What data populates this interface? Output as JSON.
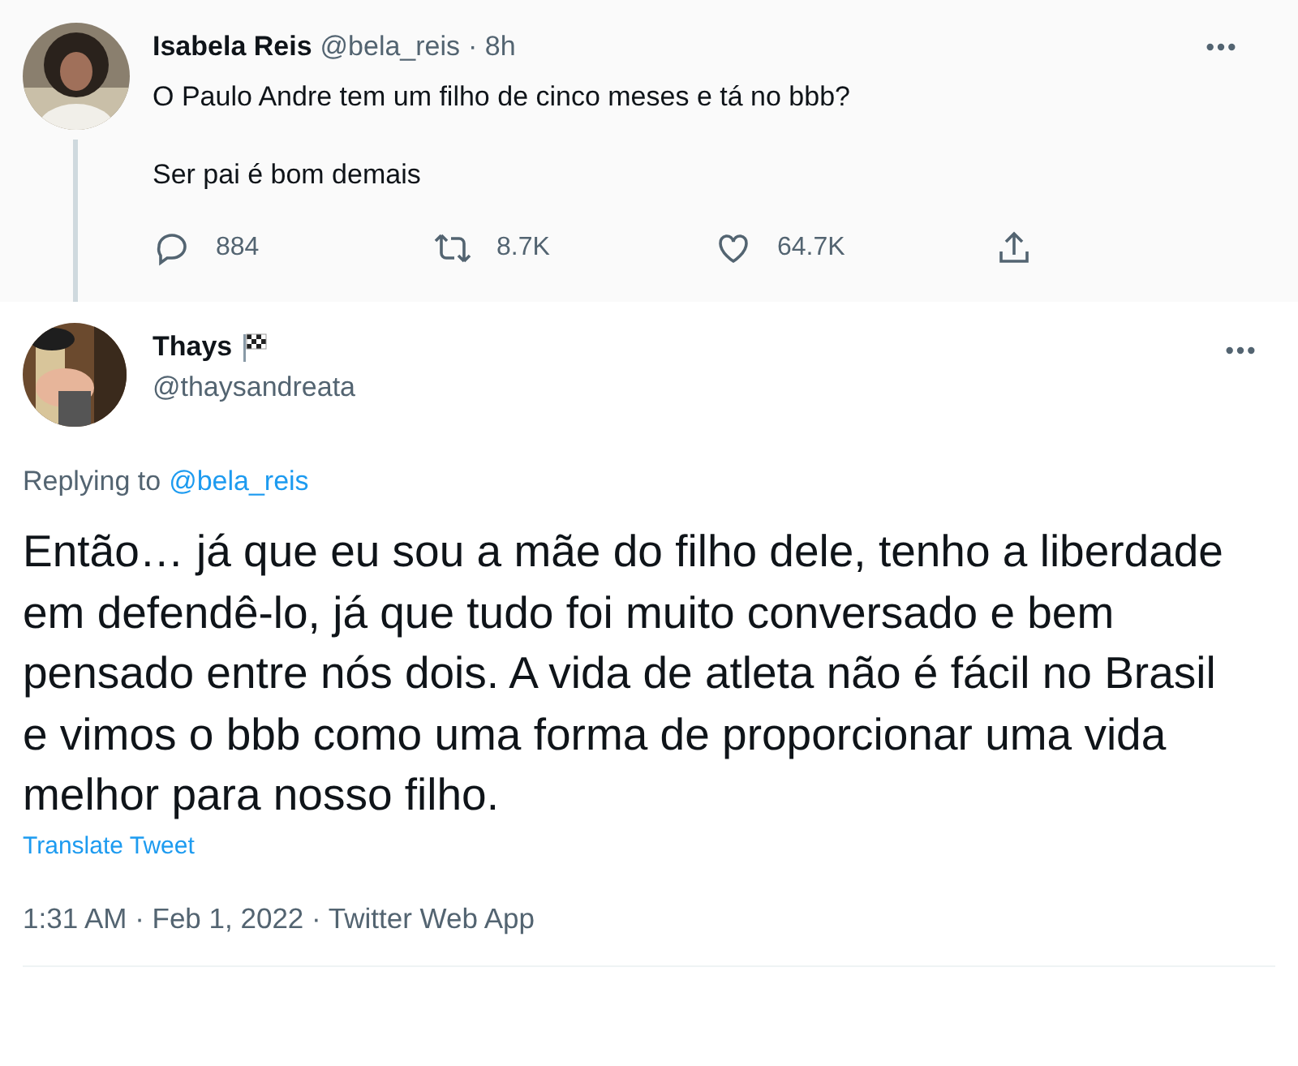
{
  "parent_tweet": {
    "name": "Isabela Reis",
    "handle": "@bela_reis",
    "time": "· 8h",
    "paragraphs": [
      "O Paulo Andre tem um filho de cinco meses e tá no bbb?",
      "Ser pai é bom demais"
    ],
    "actions": [
      {
        "kind": "reply",
        "count": "884"
      },
      {
        "kind": "retweet",
        "count": "8.7K"
      },
      {
        "kind": "like",
        "count": "64.7K"
      },
      {
        "kind": "share"
      }
    ]
  },
  "tweet": {
    "name": "Thays",
    "handle": "@thaysandreata",
    "replying_label": "Replying to",
    "replying_to": "@bela_reis",
    "text": "Então… já que eu sou a mãe do filho dele, tenho a liberdade em defendê-lo, já que tudo foi muito conversado e bem pensado entre nós dois. A vida de atleta não é fácil no Brasil e vimos o bbb como uma forma de proporcionar uma vida melhor para nosso filho.",
    "translate": "Translate Tweet",
    "meta": "1:31 AM · Feb 1, 2022 · Twitter Web App"
  }
}
